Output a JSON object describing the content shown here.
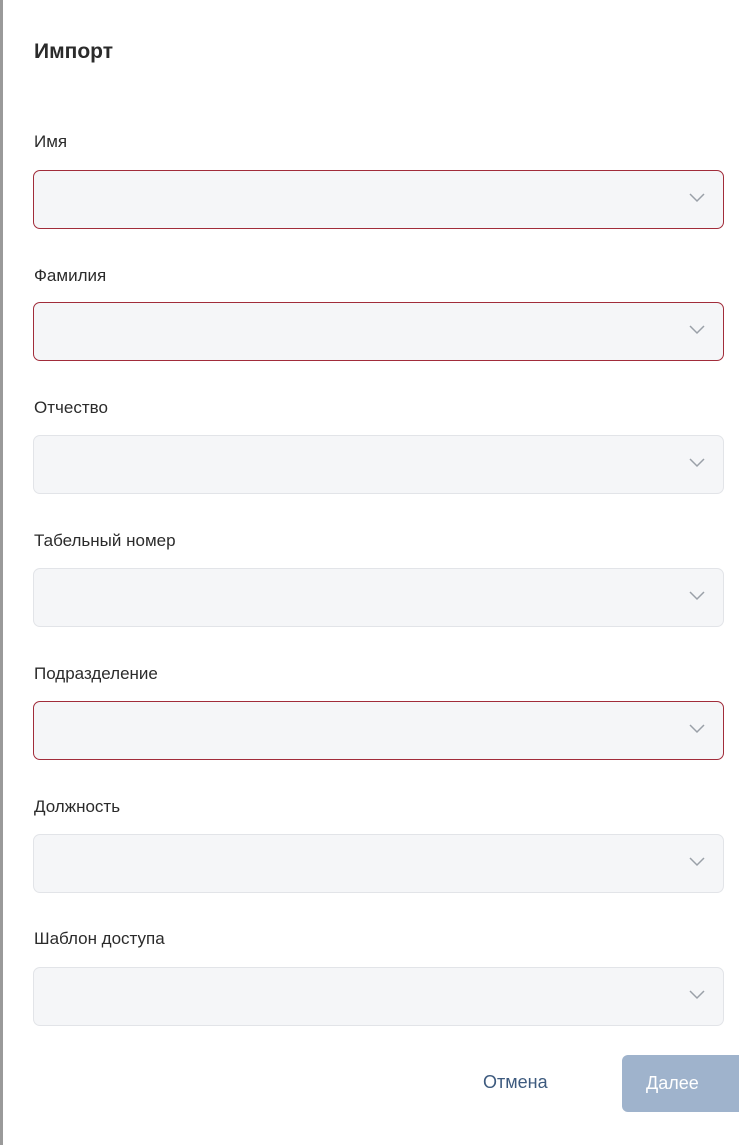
{
  "dialog": {
    "title": "Импорт",
    "fields": [
      {
        "label": "Имя",
        "value": "",
        "invalid": true
      },
      {
        "label": "Фамилия",
        "value": "",
        "invalid": true
      },
      {
        "label": "Отчество",
        "value": "",
        "invalid": false
      },
      {
        "label": "Табельный номер",
        "value": "",
        "invalid": false
      },
      {
        "label": "Подразделение",
        "value": "",
        "invalid": true
      },
      {
        "label": "Должность",
        "value": "",
        "invalid": false
      },
      {
        "label": "Шаблон доступа",
        "value": "",
        "invalid": false
      }
    ],
    "cancel_label": "Отмена",
    "next_label": "Далее",
    "colors": {
      "invalid_border": "#a12c3a",
      "field_bg": "#f5f6f8",
      "link": "#3d5a7e",
      "button_disabled": "#9fb3cc"
    },
    "icons": {
      "select_arrow": "chevron-down-icon"
    }
  }
}
